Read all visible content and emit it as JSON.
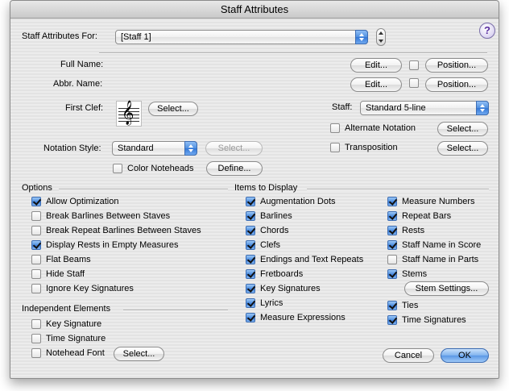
{
  "window": {
    "title": "Staff Attributes"
  },
  "top": {
    "for_label": "Staff Attributes For:",
    "staff_value": "[Staff 1]",
    "help_glyph": "?"
  },
  "names": {
    "full_name_label": "Full Name:",
    "abbr_name_label": "Abbr. Name:",
    "edit_label": "Edit...",
    "position_label": "Position..."
  },
  "clef": {
    "label": "First Clef:",
    "glyph": "𝄞",
    "select_label": "Select..."
  },
  "staff": {
    "label": "Staff:",
    "value": "Standard 5-line",
    "alternate_notation": "Alternate Notation",
    "transposition": "Transposition",
    "select_label": "Select..."
  },
  "notation": {
    "label": "Notation Style:",
    "value": "Standard",
    "select_label": "Select...",
    "color_noteheads": "Color Noteheads",
    "define_label": "Define..."
  },
  "options": {
    "header": "Options",
    "items": [
      {
        "label": "Allow Optimization",
        "checked": true
      },
      {
        "label": "Break Barlines Between Staves",
        "checked": false
      },
      {
        "label": "Break Repeat Barlines Between Staves",
        "checked": false
      },
      {
        "label": "Display Rests in Empty Measures",
        "checked": true
      },
      {
        "label": "Flat Beams",
        "checked": false
      },
      {
        "label": "Hide Staff",
        "checked": false
      },
      {
        "label": "Ignore Key Signatures",
        "checked": false
      }
    ]
  },
  "independent": {
    "header": "Independent Elements",
    "items": [
      {
        "label": "Key Signature",
        "checked": false
      },
      {
        "label": "Time Signature",
        "checked": false
      },
      {
        "label": "Notehead Font",
        "checked": false
      }
    ],
    "select_label": "Select..."
  },
  "display": {
    "header": "Items to Display",
    "col1": [
      {
        "label": "Augmentation Dots",
        "checked": true
      },
      {
        "label": "Barlines",
        "checked": true
      },
      {
        "label": "Chords",
        "checked": true
      },
      {
        "label": "Clefs",
        "checked": true
      },
      {
        "label": "Endings and Text Repeats",
        "checked": true
      },
      {
        "label": "Fretboards",
        "checked": true
      },
      {
        "label": "Key Signatures",
        "checked": true
      },
      {
        "label": "Lyrics",
        "checked": true
      },
      {
        "label": "Measure Expressions",
        "checked": true
      }
    ],
    "col2": [
      {
        "label": "Measure Numbers",
        "checked": true
      },
      {
        "label": "Repeat Bars",
        "checked": true
      },
      {
        "label": "Rests",
        "checked": true
      },
      {
        "label": "Staff Name in Score",
        "checked": true
      },
      {
        "label": "Staff Name in Parts",
        "checked": false
      },
      {
        "label": "Stems",
        "checked": true
      },
      {
        "label": "Ties",
        "checked": true
      },
      {
        "label": "Time Signatures",
        "checked": true
      }
    ],
    "stem_settings_label": "Stem Settings..."
  },
  "footer": {
    "cancel_label": "Cancel",
    "ok_label": "OK"
  }
}
